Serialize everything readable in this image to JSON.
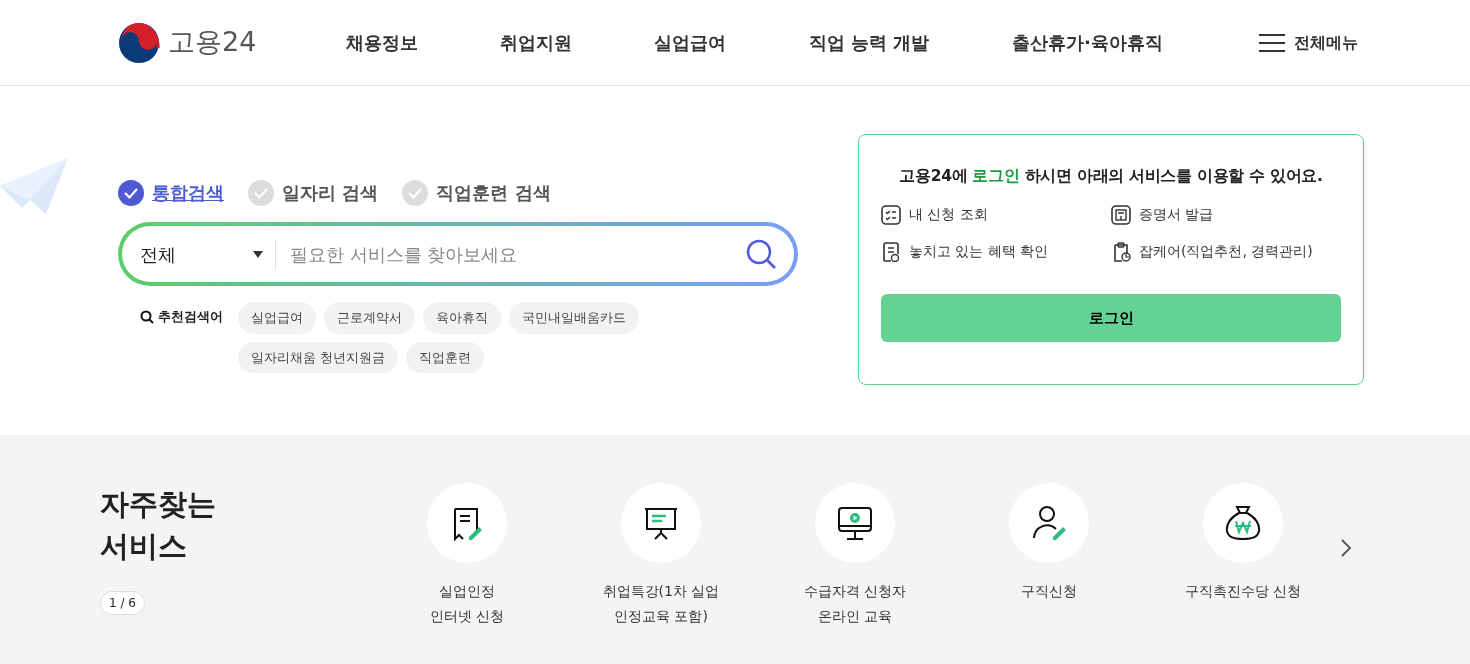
{
  "header": {
    "logo_text": "고용24",
    "nav": [
      "채용정보",
      "취업지원",
      "실업급여",
      "직업 능력 개발",
      "출산휴가·육아휴직"
    ],
    "all_menu": "전체메뉴"
  },
  "search": {
    "tabs": [
      {
        "label": "통합검색",
        "selected": true
      },
      {
        "label": "일자리 검색",
        "selected": false
      },
      {
        "label": "직업훈련 검색",
        "selected": false
      }
    ],
    "category": "전체",
    "placeholder": "필요한 서비스를 찾아보세요",
    "recommended_label": "추천검색어",
    "keywords": [
      "실업급여",
      "근로계약서",
      "육아휴직",
      "국민내일배움카드",
      "일자리채움 청년지원금",
      "직업훈련"
    ]
  },
  "login_card": {
    "heading": [
      {
        "text": "고용24에 ",
        "highlight": false
      },
      {
        "text": "로그인",
        "highlight": true
      },
      {
        "text": " 하시면 아래의 서비스를 이용할 수 있어요.",
        "highlight": false
      }
    ],
    "services": [
      {
        "kind": "checklist",
        "label": "내 신청 조회"
      },
      {
        "kind": "certificate",
        "label": "증명서 발급"
      },
      {
        "kind": "document",
        "label": "놓치고 있는 혜택 확인"
      },
      {
        "kind": "clipboard",
        "label": "잡케어(직업추천, 경력관리)"
      }
    ],
    "button": "로그인"
  },
  "frequent_services": {
    "title": "자주찾는\n서비스",
    "pager": "1 / 6",
    "items": [
      {
        "kind": "receipt",
        "label": "실업인정\n인터넷 신청"
      },
      {
        "kind": "presentation",
        "label": "취업특강(1차 실업\n인정교육 포함)"
      },
      {
        "kind": "monitor",
        "label": "수급자격 신청자\n온라인 교육"
      },
      {
        "kind": "person",
        "label": "구직신청"
      },
      {
        "kind": "moneybag",
        "label": "구직촉진수당 신청"
      }
    ]
  }
}
